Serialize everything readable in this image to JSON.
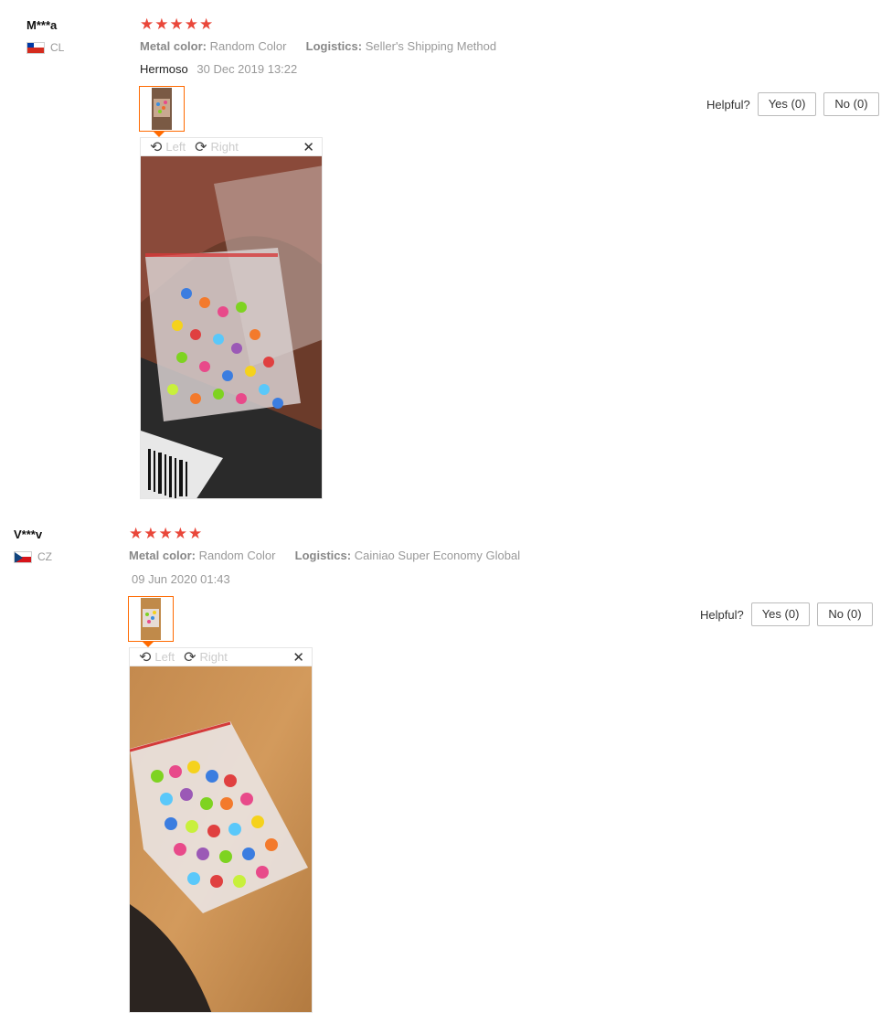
{
  "reviews": [
    {
      "user": "M***a",
      "country": "CL",
      "stars": 5,
      "metal_label": "Metal color:",
      "metal_value": "Random Color",
      "logistics_label": "Logistics:",
      "logistics_value": "Seller's Shipping Method",
      "comment": "Hermoso",
      "date": "30 Dec 2019 13:22",
      "rotate_left": "Left",
      "rotate_right": "Right",
      "helpful_label": "Helpful?",
      "yes_label": "Yes (0)",
      "no_label": "No (0)"
    },
    {
      "user": "V***v",
      "country": "CZ",
      "stars": 5,
      "metal_label": "Metal color:",
      "metal_value": "Random Color",
      "logistics_label": "Logistics:",
      "logistics_value": "Cainiao Super Economy Global",
      "comment": "",
      "date": "09 Jun 2020 01:43",
      "rotate_left": "Left",
      "rotate_right": "Right",
      "helpful_label": "Helpful?",
      "yes_label": "Yes (0)",
      "no_label": "No (0)"
    }
  ],
  "icons": {
    "star": "star-icon",
    "rotate_left": "rotate-left-icon",
    "rotate_right": "rotate-right-icon",
    "close": "close-icon"
  },
  "colors": {
    "star": "#e9473a",
    "thumb_border": "#ff6a00"
  }
}
